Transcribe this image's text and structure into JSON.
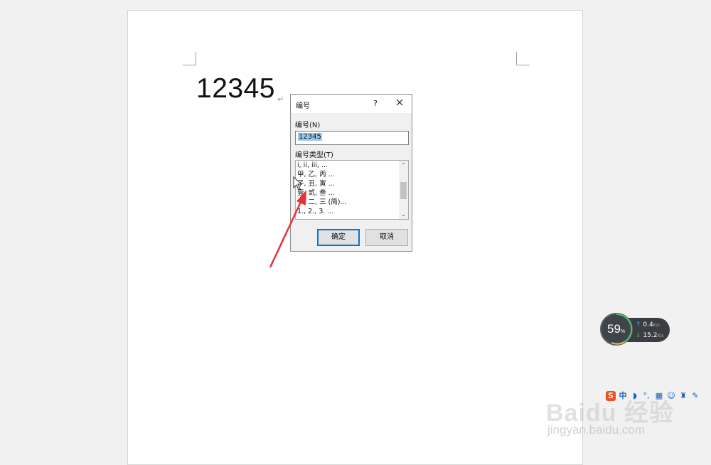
{
  "document": {
    "text": "12345",
    "paragraph_mark": "↵"
  },
  "dialog": {
    "title": "编号",
    "help": "?",
    "number_label": "编号(N)",
    "number_value": "12345",
    "type_label": "编号类型(T)",
    "type_options": [
      "i, ii, iii, ...",
      "甲, 乙, 丙 ...",
      "子, 丑, 寅 ...",
      "壹, 贰, 叁 ...",
      "一, 二, 三 (简)...",
      "1., 2., 3. ..."
    ],
    "ok_label": "确定",
    "cancel_label": "取消"
  },
  "net_widget": {
    "percent": "59",
    "percent_unit": "%",
    "upload": "0.4",
    "download": "15.2",
    "unit": "K/s"
  },
  "ime_bar": {
    "mode": "中"
  },
  "watermark": {
    "logo": "Baidu 经验",
    "url": "jingyan.baidu.com"
  },
  "colors": {
    "accent": "#0078d7",
    "selection": "#99c9ef",
    "arrow": "#e53333",
    "sogou": "#f04e23"
  }
}
